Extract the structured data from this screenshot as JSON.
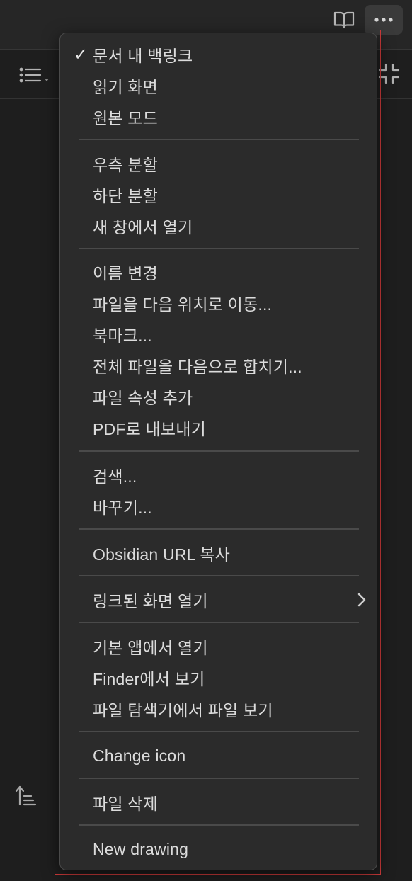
{
  "menu": {
    "items": [
      {
        "label": "문서 내 백링크",
        "checked": true
      },
      {
        "label": "읽기 화면"
      },
      {
        "label": "원본 모드"
      },
      {
        "label": "우측 분할"
      },
      {
        "label": "하단 분할"
      },
      {
        "label": "새 창에서 열기"
      },
      {
        "label": "이름 변경"
      },
      {
        "label": "파일을 다음 위치로 이동..."
      },
      {
        "label": "북마크..."
      },
      {
        "label": "전체 파일을 다음으로 합치기..."
      },
      {
        "label": "파일 속성 추가"
      },
      {
        "label": "PDF로 내보내기"
      },
      {
        "label": "검색..."
      },
      {
        "label": "바꾸기..."
      },
      {
        "label": "Obsidian URL 복사"
      },
      {
        "label": "링크된 화면 열기",
        "submenu": true
      },
      {
        "label": "기본 앱에서 열기"
      },
      {
        "label": "Finder에서 보기"
      },
      {
        "label": "파일 탐색기에서 파일 보기"
      },
      {
        "label": "Change icon"
      },
      {
        "label": "파일 삭제"
      },
      {
        "label": "New drawing"
      }
    ],
    "check_mark": "✓"
  },
  "icons": {
    "reading_view": "book-open-icon",
    "more_options": "more-horizontal-icon",
    "outline": "list-icon",
    "collapse": "minimize-icon",
    "sort": "sort-ascending-icon"
  },
  "colors": {
    "background": "#1e1e1e",
    "menu_bg": "#2b2b2b",
    "menu_text": "#dcdcdc",
    "separator": "#4a4a4a",
    "focus_ring": "#d23b3b"
  }
}
